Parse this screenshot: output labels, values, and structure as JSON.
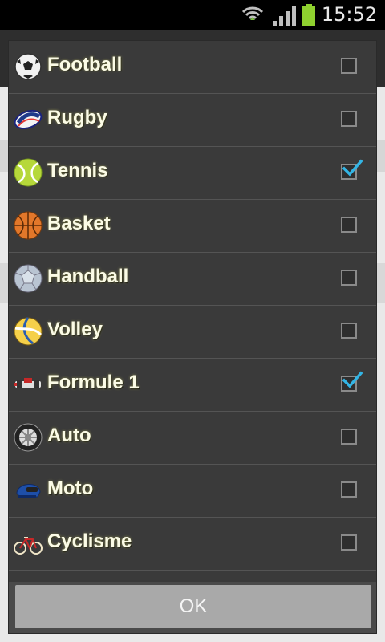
{
  "status_bar": {
    "time": "15:52"
  },
  "dialog": {
    "items": [
      {
        "label": "Football",
        "checked": false,
        "icon": "soccer-ball-icon"
      },
      {
        "label": "Rugby",
        "checked": false,
        "icon": "rugby-ball-icon"
      },
      {
        "label": "Tennis",
        "checked": true,
        "icon": "tennis-ball-icon"
      },
      {
        "label": "Basket",
        "checked": false,
        "icon": "basketball-icon"
      },
      {
        "label": "Handball",
        "checked": false,
        "icon": "handball-icon"
      },
      {
        "label": "Volley",
        "checked": false,
        "icon": "volleyball-icon"
      },
      {
        "label": "Formule 1",
        "checked": true,
        "icon": "f1-car-icon"
      },
      {
        "label": "Auto",
        "checked": false,
        "icon": "wheel-icon"
      },
      {
        "label": "Moto",
        "checked": false,
        "icon": "helmet-icon"
      },
      {
        "label": "Cyclisme",
        "checked": false,
        "icon": "bicycle-icon"
      }
    ],
    "ok_label": "OK"
  },
  "colors": {
    "check": "#33b5e5",
    "label": "#fbfbe6"
  }
}
